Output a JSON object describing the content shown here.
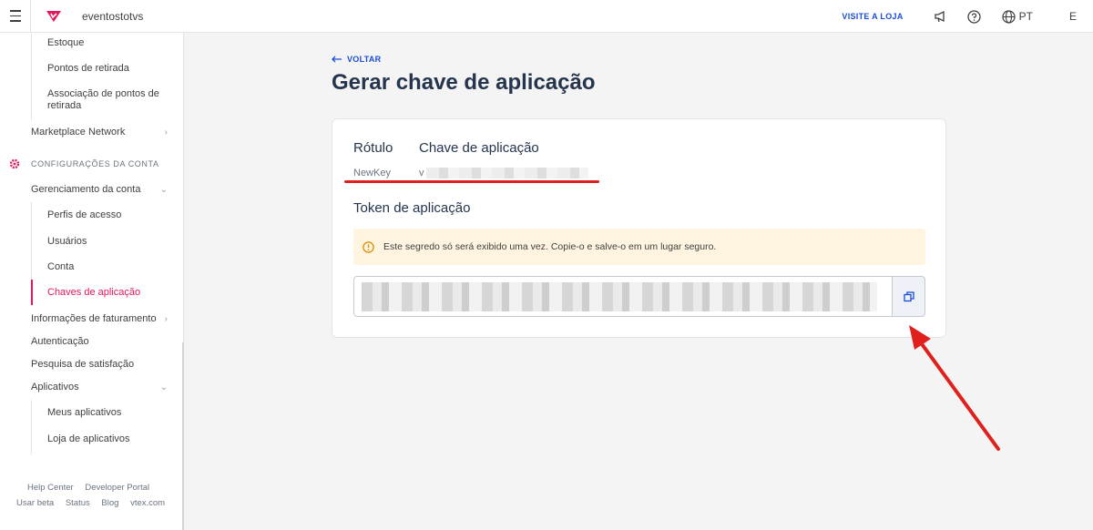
{
  "topbar": {
    "account_name": "eventostotvs",
    "visit_store": "VISITE A LOJA",
    "language": "PT",
    "user_initial": "E"
  },
  "sidebar": {
    "items": [
      {
        "label": "Estoque"
      },
      {
        "label": "Pontos de retirada"
      },
      {
        "label": "Associação de pontos de retirada"
      },
      {
        "label": "Marketplace Network"
      },
      {
        "label": "CONFIGURAÇÕES DA CONTA"
      },
      {
        "label": "Gerenciamento da conta"
      },
      {
        "label": "Perfis de acesso"
      },
      {
        "label": "Usuários"
      },
      {
        "label": "Conta"
      },
      {
        "label": "Chaves de aplicação"
      },
      {
        "label": "Informações de faturamento"
      },
      {
        "label": "Autenticação"
      },
      {
        "label": "Pesquisa de satisfação"
      },
      {
        "label": "Aplicativos"
      },
      {
        "label": "Meus aplicativos"
      },
      {
        "label": "Loja de aplicativos"
      }
    ],
    "footer_links": [
      "Help Center",
      "Developer Portal",
      "Usar beta",
      "Status",
      "Blog",
      "vtex.com"
    ]
  },
  "main": {
    "back_label": "VOLTAR",
    "title": "Gerar chave de aplicação",
    "card": {
      "label_header": "Rótulo",
      "key_header": "Chave de aplicação",
      "label_value": "NewKey",
      "key_value_prefix": "v",
      "token_title": "Token de aplicação",
      "warning_text": "Este segredo só será exibido uma vez. Copie-o e salve-o em um lugar seguro."
    }
  },
  "colors": {
    "accent": "#1a4dd6",
    "brand": "#e3185a",
    "annotation": "#e0201d",
    "warning_bg": "#fff4e0"
  }
}
